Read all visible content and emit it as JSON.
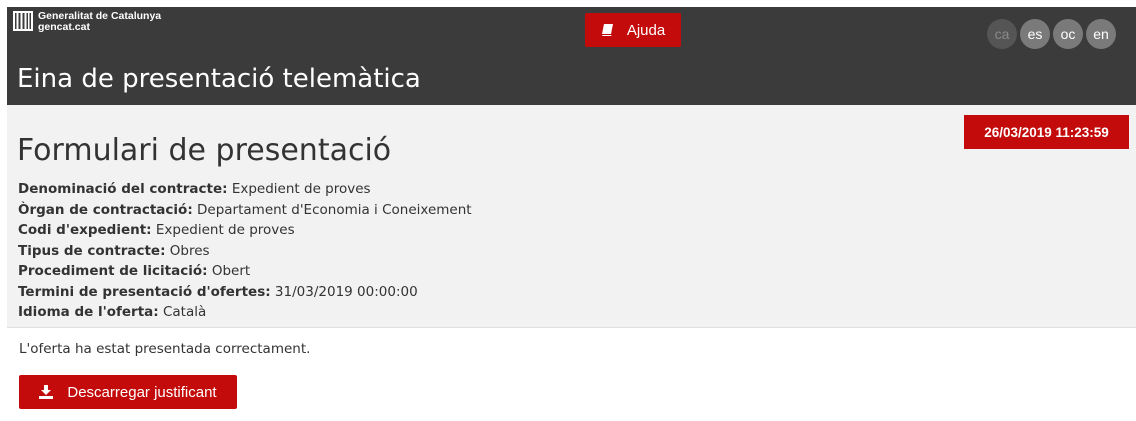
{
  "header": {
    "logo_line1": "Generalitat de Catalunya",
    "logo_line2": "gencat.cat",
    "help_label": "Ajuda",
    "app_title": "Eina de presentació telemàtica",
    "languages": [
      "ca",
      "es",
      "oc",
      "en"
    ],
    "current_language": "ca"
  },
  "form": {
    "datetime": "26/03/2019 11:23:59",
    "title": "Formulari de presentació",
    "fields": [
      {
        "label": "Denominació del contracte:",
        "value": " Expedient de proves"
      },
      {
        "label": "Òrgan de contractació:",
        "value": " Departament d'Economia i Coneixement"
      },
      {
        "label": "Codi d'expedient:",
        "value": " Expedient de proves"
      },
      {
        "label": "Tipus de contracte:",
        "value": " Obres"
      },
      {
        "label": "Procediment de licitació:",
        "value": " Obert"
      },
      {
        "label": "Termini de presentació d'ofertes:",
        "value": " 31/03/2019 00:00:00"
      },
      {
        "label": "Idioma de l'oferta:",
        "value": " Català"
      }
    ]
  },
  "result": {
    "message": "L'oferta ha estat presentada correctament.",
    "download_label": "Descarregar justificant"
  },
  "colors": {
    "header_bg": "#3b3b3b",
    "accent_red": "#c40b0b",
    "panel_bg": "#f2f2f2"
  },
  "icons": {
    "logo": "generalitat-logo-icon",
    "help": "book-icon",
    "download": "download-icon"
  }
}
